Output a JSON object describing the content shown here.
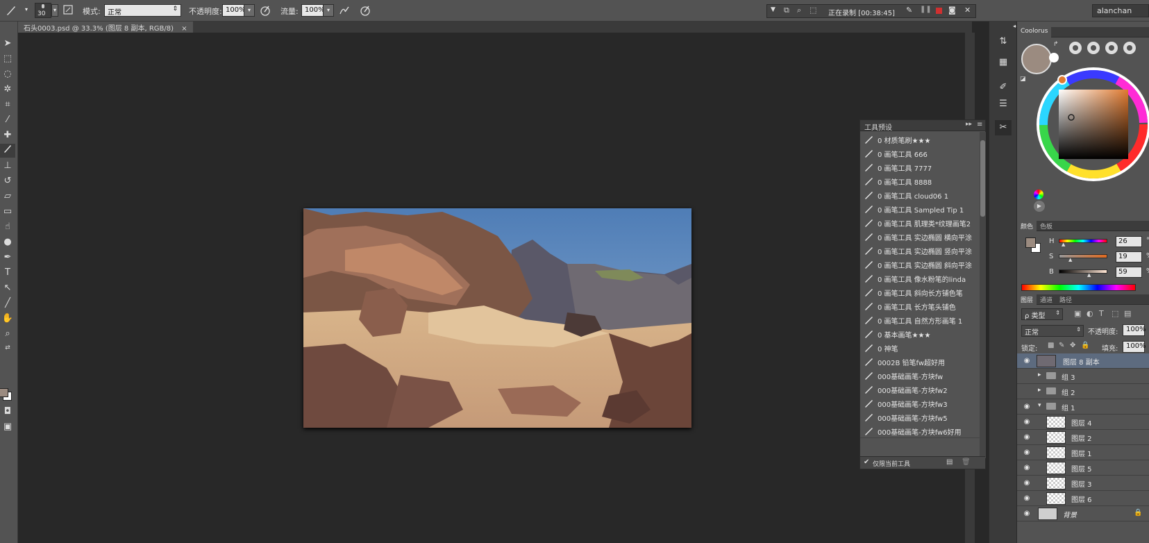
{
  "options_bar": {
    "brush_size": "30",
    "mode_label": "模式:",
    "mode_value": "正常",
    "opacity_label": "不透明度:",
    "opacity_value": "100%",
    "flow_label": "流量:",
    "flow_value": "100%",
    "recording_text": "正在录制 [00:38:45]",
    "user_name": "alanchan"
  },
  "document": {
    "tab_label": "石头0003.psd @ 33.3% (图层 8 副本, RGB/8)",
    "close_symbol": "×"
  },
  "tool_presets": {
    "title": "工具预设",
    "items": [
      "0 材质笔刷★★★",
      "0 画笔工具  666",
      "0 画笔工具 7777",
      "0 画笔工具 8888",
      "0 画笔工具 cloud06 1",
      "0 画笔工具 Sampled Tip 1",
      "0 画笔工具 肌理类*纹理画笔2",
      "0 画笔工具 实边椭圆 横向平涂",
      "0 画笔工具 实边椭圆 竖向平涂",
      "0 画笔工具 实边椭圆 斜向平涂",
      "0 画笔工具 像水粉笔的linda",
      "0 画笔工具 斜向长方铺色笔",
      "0 画笔工具 长方笔头铺色",
      "0 画笔工具 自然方形画笔 1",
      "0 基本画笔★★★",
      "0 神笔",
      "0002B 铅笔fw超好用",
      "000基础画笔-方块fw",
      "000基础画笔-方块fw2",
      "000基础画笔-方块fw3",
      "000基础画笔-方块fw5",
      "000基础画笔-方块fw6好用"
    ],
    "footer_checkbox": "仅限当前工具"
  },
  "coolorus": {
    "tab": "Coolorus",
    "current_color": "#9b8b80"
  },
  "color_panel": {
    "tabs": [
      "颜色",
      "色板"
    ],
    "h_label": "H",
    "h_value": "26",
    "h_unit": "°",
    "s_label": "S",
    "s_value": "19",
    "s_unit": "%",
    "b_label": "B",
    "b_value": "59",
    "b_unit": "%"
  },
  "layers_panel": {
    "tabs": [
      "图层",
      "通道",
      "路径"
    ],
    "filter_label": "ρ 类型",
    "blend_mode": "正常",
    "opacity_label": "不透明度:",
    "opacity_value": "100%",
    "lock_label": "锁定:",
    "fill_label": "填充:",
    "fill_value": "100%",
    "layers": [
      {
        "name": "图层 8 副本",
        "selected": true,
        "type": "layer",
        "indent": 0,
        "visible": true
      },
      {
        "name": "组 3",
        "selected": false,
        "type": "group-collapsed",
        "indent": 0,
        "visible": false
      },
      {
        "name": "组 2",
        "selected": false,
        "type": "group-collapsed",
        "indent": 0,
        "visible": false
      },
      {
        "name": "组 1",
        "selected": false,
        "type": "group-open",
        "indent": 0,
        "visible": true
      },
      {
        "name": "图层 4",
        "selected": false,
        "type": "layer",
        "indent": 1,
        "visible": true
      },
      {
        "name": "图层 2",
        "selected": false,
        "type": "layer",
        "indent": 1,
        "visible": true
      },
      {
        "name": "图层 1",
        "selected": false,
        "type": "layer",
        "indent": 1,
        "visible": true
      },
      {
        "name": "图层 5",
        "selected": false,
        "type": "layer",
        "indent": 1,
        "visible": true
      },
      {
        "name": "图层 3",
        "selected": false,
        "type": "layer",
        "indent": 1,
        "visible": true
      },
      {
        "name": "图层 6",
        "selected": false,
        "type": "layer",
        "indent": 1,
        "visible": true
      },
      {
        "name": "背景",
        "selected": false,
        "type": "background",
        "indent": 0,
        "visible": true
      }
    ]
  }
}
